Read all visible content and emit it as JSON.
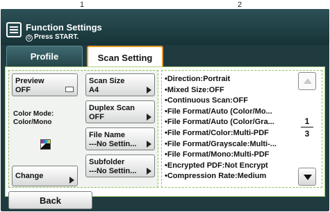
{
  "callouts": [
    "1",
    "2"
  ],
  "header": {
    "title": "Function Settings",
    "subtitle": "Press START."
  },
  "tabs": [
    {
      "label": "Profile",
      "active": false
    },
    {
      "label": "Scan Setting",
      "active": true
    }
  ],
  "left_panel": {
    "preview": {
      "label": "Preview",
      "value": "OFF"
    },
    "color_mode": {
      "label": "Color Mode:",
      "value": "Color/Mono",
      "icon": "color-mono-icon"
    },
    "change": {
      "label": "Change"
    },
    "scan_size": {
      "label": "Scan Size",
      "value": "A4"
    },
    "duplex_scan": {
      "label": "Duplex Scan",
      "value": "OFF"
    },
    "file_name": {
      "label": "File Name",
      "value": "---No Settin..."
    },
    "subfolder": {
      "label": "Subfolder",
      "value": "---No Settin..."
    }
  },
  "summary": [
    "•Direction:Portrait",
    "•Mixed Size:OFF",
    "•Continuous Scan:OFF",
    "•File Format/Auto (Color/Mo...",
    "•File Format/Auto (Color/Gra...",
    "•File Format/Color:Multi-PDF",
    "•File Format/Grayscale:Multi-...",
    "•File Format/Mono:Multi-PDF",
    "•Encrypted PDF:Not Encrypt",
    "•Compression Rate:Medium"
  ],
  "pagination": {
    "current": "1",
    "total": "3"
  },
  "footer": {
    "back_label": "Back"
  },
  "colors": {
    "header_bg": "#1f3b40",
    "active_tab_border": "#e79b2a",
    "panel_border": "#8bc15a"
  }
}
